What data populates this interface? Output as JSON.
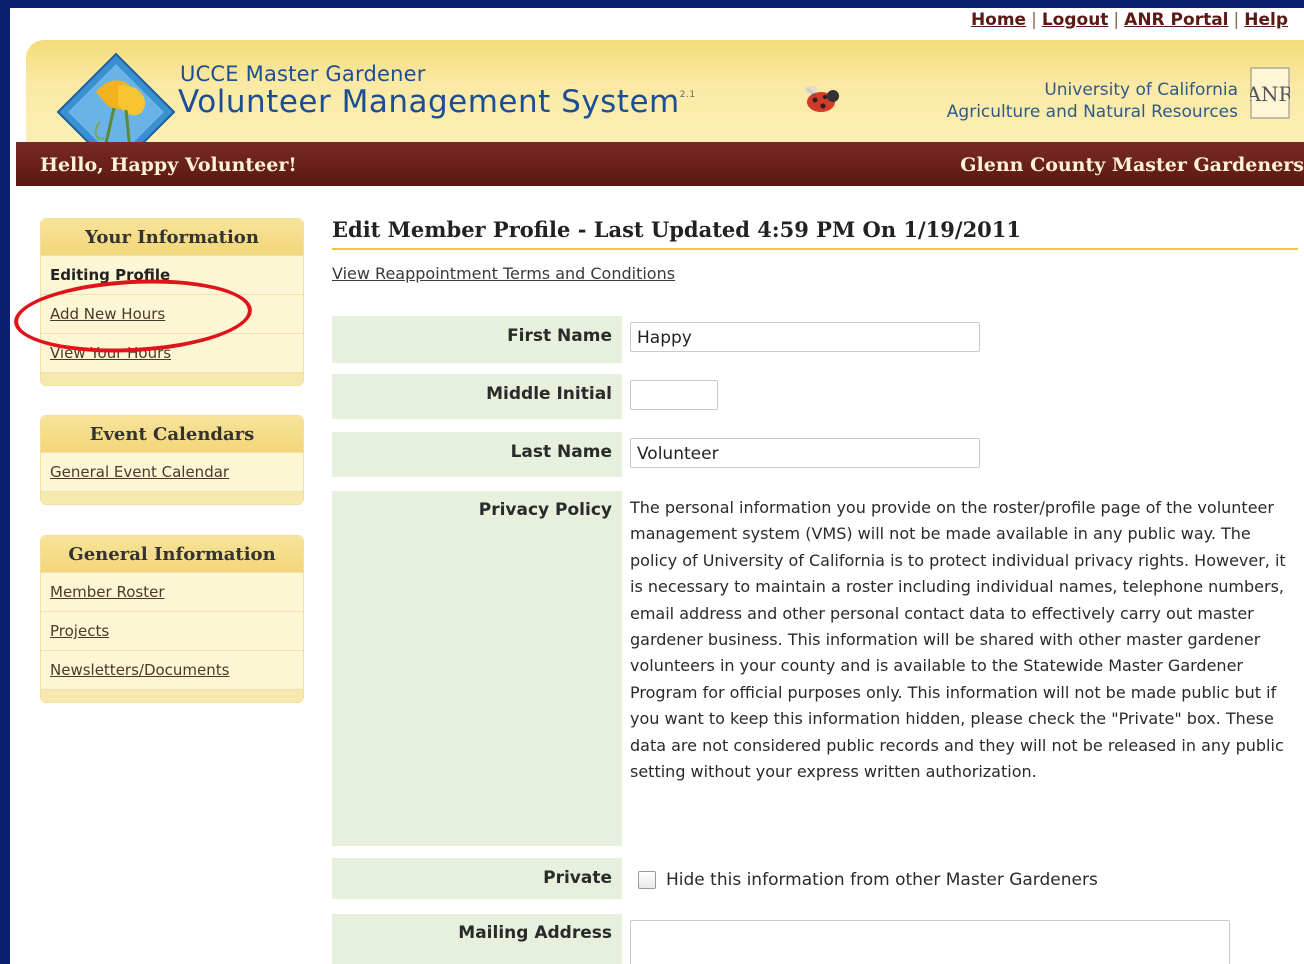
{
  "top_links": [
    "Home",
    "Logout",
    "ANR Portal",
    "Help"
  ],
  "header": {
    "title_line1": "UCCE Master Gardener",
    "title_line2": "Volunteer Management System",
    "version": "2.1",
    "uc_line1": "University of California",
    "uc_line2": "Agriculture and Natural Resources",
    "logo_text": "ANR"
  },
  "greeting": "Hello, Happy Volunteer!",
  "county": "Glenn County Master Gardeners",
  "sidebar": {
    "your_information": {
      "title": "Your Information",
      "items": [
        "Editing Profile",
        "Add New Hours",
        "View Your Hours"
      ]
    },
    "event_calendars": {
      "title": "Event Calendars",
      "items": [
        "General Event Calendar"
      ]
    },
    "general_information": {
      "title": "General Information",
      "items": [
        "Member Roster",
        "Projects",
        "Newsletters/Documents"
      ]
    }
  },
  "main": {
    "title": "Edit Member Profile - Last Updated 4:59 PM On 1/19/2011",
    "terms_link": "View Reappointment Terms and Conditions",
    "fields": {
      "first_name": {
        "label": "First Name",
        "value": "Happy"
      },
      "middle_initial": {
        "label": "Middle Initial",
        "value": ""
      },
      "last_name": {
        "label": "Last Name",
        "value": "Volunteer"
      },
      "privacy_policy": {
        "label": "Privacy Policy",
        "text": "The personal information you provide on the roster/profile page of the volunteer management system (VMS) will not be made available in any public way. The policy of University of California is to protect individual privacy rights. However, it is necessary to maintain a roster including individual names, telephone numbers, email address and other personal contact data to effectively carry out master gardener business. This information will be shared with other master gardener volunteers in your county and is available to the Statewide Master Gardener Program for official purposes only. This information will not be made public but if you want to keep this information hidden, please check the \"Private\" box. These data are not considered public records and they will not be released in any public setting without your express written authorization."
      },
      "private": {
        "label": "Private",
        "checkbox_label": "Hide this information from other Master Gardeners",
        "checked": false
      },
      "mailing_address": {
        "label": "Mailing Address",
        "value": ""
      }
    }
  },
  "colors": {
    "frame": "#0c1f6e",
    "banner": "#6a1f1a",
    "accent": "#f0c63c",
    "highlight_circle": "#e0121a"
  }
}
